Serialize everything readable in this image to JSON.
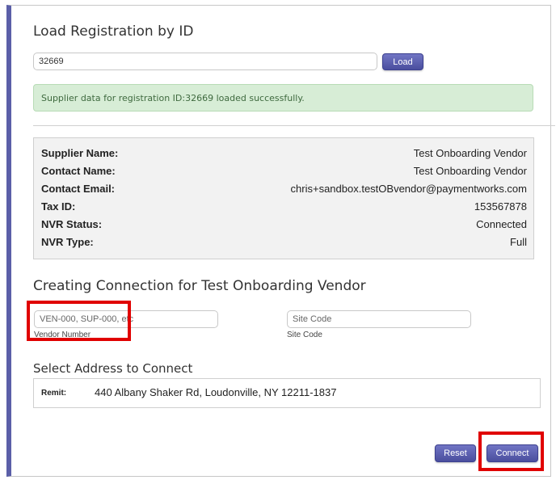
{
  "load_section": {
    "title": "Load Registration by ID",
    "registration_id_value": "32669",
    "load_button_label": "Load"
  },
  "alert": {
    "message": "Supplier data for registration ID:32669 loaded successfully."
  },
  "supplier_info": {
    "rows": [
      {
        "label": "Supplier Name:",
        "value": "Test Onboarding Vendor"
      },
      {
        "label": "Contact Name:",
        "value": "Test Onboarding Vendor"
      },
      {
        "label": "Contact Email:",
        "value": "chris+sandbox.testOBvendor@paymentworks.com"
      },
      {
        "label": "Tax ID:",
        "value": "153567878"
      },
      {
        "label": "NVR Status:",
        "value": "Connected"
      },
      {
        "label": "NVR Type:",
        "value": "Full"
      }
    ]
  },
  "connection": {
    "title": "Creating Connection for Test Onboarding Vendor",
    "vendor_number": {
      "placeholder": "VEN-000, SUP-000, etc",
      "value": "",
      "label": "Vendor Number"
    },
    "site_code": {
      "placeholder": "Site Code",
      "value": "",
      "label": "Site Code"
    }
  },
  "address_section": {
    "title": "Select Address to Connect",
    "address_type": "Remit:",
    "address": "440 Albany Shaker Rd, Loudonville, NY 12211-1837"
  },
  "actions": {
    "reset_label": "Reset",
    "connect_label": "Connect"
  },
  "colors": {
    "accent": "#5b5fa8",
    "button": "#4a4e9e",
    "success_bg": "#d7edd6",
    "success_text": "#3f6a3f",
    "highlight": "#e00000"
  }
}
